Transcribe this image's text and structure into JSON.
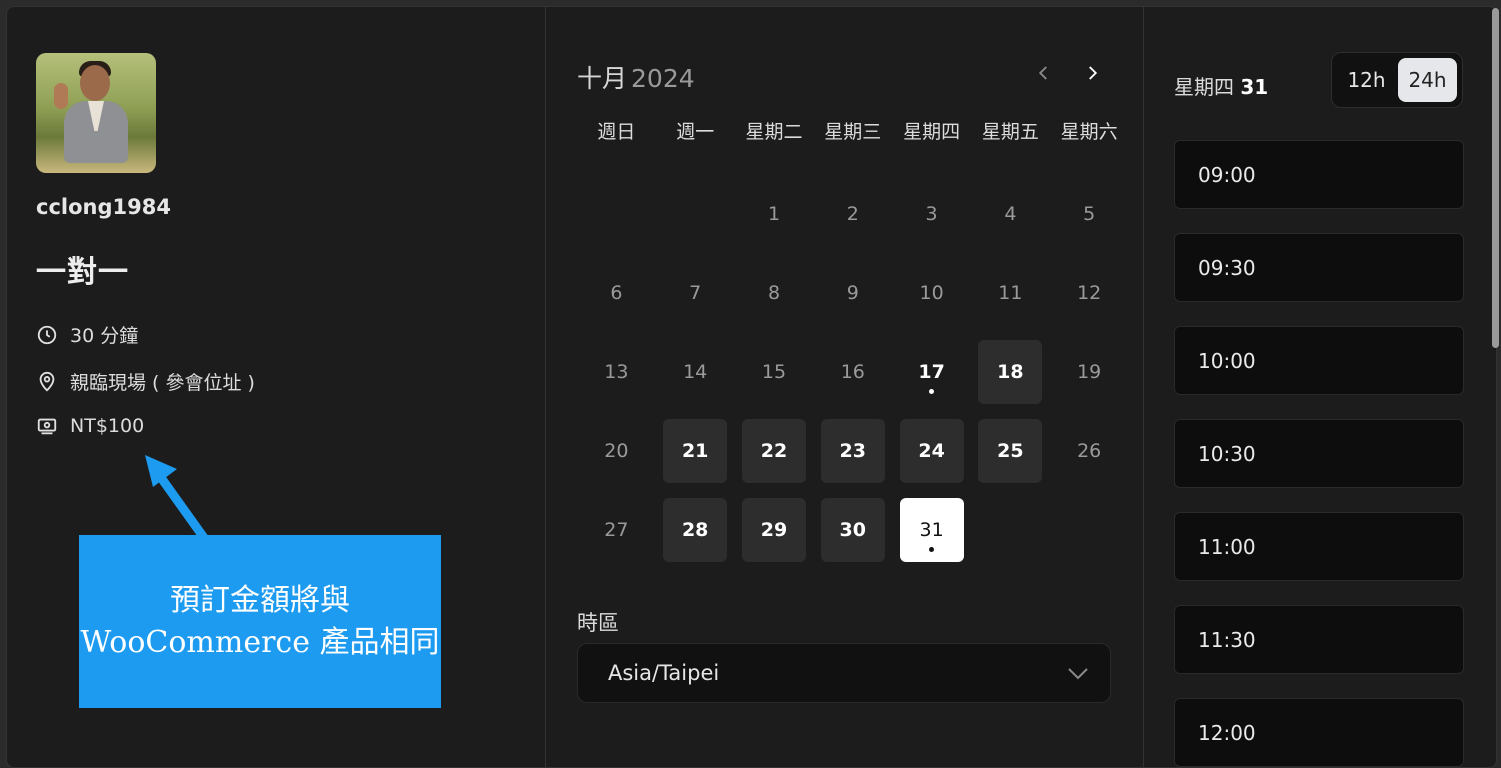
{
  "profile": {
    "username": "cclong1984",
    "event_title": "一對一",
    "duration": "30 分鐘",
    "location": "親臨現場 ( 參會位址 )",
    "price": "NT$100"
  },
  "callout": {
    "line1": "預訂金額將與",
    "line2": "WooCommerce 產品相同",
    "color": "#1d9bf0"
  },
  "calendar": {
    "month": "十月",
    "year": "2024",
    "weekdays": [
      "週日",
      "週一",
      "星期二",
      "星期三",
      "星期四",
      "星期五",
      "星期六"
    ],
    "leading_blanks": 2,
    "days": [
      {
        "d": "1",
        "s": "off"
      },
      {
        "d": "2",
        "s": "off"
      },
      {
        "d": "3",
        "s": "off"
      },
      {
        "d": "4",
        "s": "off"
      },
      {
        "d": "5",
        "s": "off"
      },
      {
        "d": "6",
        "s": "off"
      },
      {
        "d": "7",
        "s": "off"
      },
      {
        "d": "8",
        "s": "off"
      },
      {
        "d": "9",
        "s": "off"
      },
      {
        "d": "10",
        "s": "off"
      },
      {
        "d": "11",
        "s": "off"
      },
      {
        "d": "12",
        "s": "off"
      },
      {
        "d": "13",
        "s": "off"
      },
      {
        "d": "14",
        "s": "off"
      },
      {
        "d": "15",
        "s": "off"
      },
      {
        "d": "16",
        "s": "off"
      },
      {
        "d": "17",
        "s": "today"
      },
      {
        "d": "18",
        "s": "avail"
      },
      {
        "d": "19",
        "s": "off"
      },
      {
        "d": "20",
        "s": "off"
      },
      {
        "d": "21",
        "s": "avail"
      },
      {
        "d": "22",
        "s": "avail"
      },
      {
        "d": "23",
        "s": "avail"
      },
      {
        "d": "24",
        "s": "avail"
      },
      {
        "d": "25",
        "s": "avail"
      },
      {
        "d": "26",
        "s": "off"
      },
      {
        "d": "27",
        "s": "off"
      },
      {
        "d": "28",
        "s": "avail"
      },
      {
        "d": "29",
        "s": "avail"
      },
      {
        "d": "30",
        "s": "avail"
      },
      {
        "d": "31",
        "s": "selected"
      }
    ],
    "prev_icon": "chevron-left-icon",
    "next_icon": "chevron-right-icon"
  },
  "timezone": {
    "label": "時區",
    "value": "Asia/Taipei"
  },
  "times": {
    "weekday": "星期四",
    "day": "31",
    "format_12": "12h",
    "format_24": "24h",
    "active_format": "24h",
    "slots": [
      "09:00",
      "09:30",
      "10:00",
      "10:30",
      "11:00",
      "11:30",
      "12:00"
    ]
  }
}
